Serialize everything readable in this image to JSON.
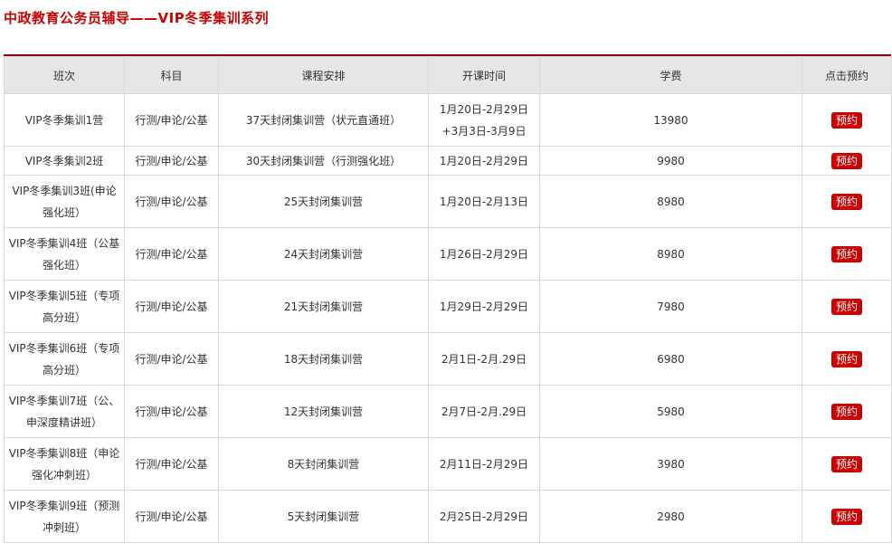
{
  "page": {
    "title": "中政教育公务员辅导——VIP冬季集训系列"
  },
  "colors": {
    "accent": "#cc0000",
    "header_bg": "#e6e6e6",
    "class_text": "#5a3b5c"
  },
  "table": {
    "headers": [
      "班次",
      "科目",
      "课程安排",
      "开课时间",
      "学费",
      "点击预约"
    ],
    "reserve_label": "预约",
    "rows": [
      {
        "class": "VIP冬季集训1营",
        "subject": "行测/申论/公基",
        "schedule": "37天封闭集训营（状元直通班）",
        "start": "1月20日-2月29日+3月3日-3月9日",
        "fee": "13980"
      },
      {
        "class": "VIP冬季集训2班",
        "subject": "行测/申论/公基",
        "schedule": "30天封闭集训营（行测强化班）",
        "start": "1月20日-2月29日",
        "fee": "9980"
      },
      {
        "class": "VIP冬季集训3班(申论强化班）",
        "subject": "行测/申论/公基",
        "schedule": "25天封闭集训营",
        "start": "1月20日-2月13日",
        "fee": "8980"
      },
      {
        "class": "VIP冬季集训4班（公基强化班）",
        "subject": "行测/申论/公基",
        "schedule": "24天封闭集训营",
        "start": "1月26日-2月29日",
        "fee": "8980"
      },
      {
        "class": "VIP冬季集训5班（专项高分班）",
        "subject": "行测/申论/公基",
        "schedule": "21天封闭集训营",
        "start": "1月29日-2月29日",
        "fee": "7980"
      },
      {
        "class": "VIP冬季集训6班（专项高分班）",
        "subject": "行测/申论/公基",
        "schedule": "18天封闭集训营",
        "start": "2月1日-2月.29日",
        "fee": "6980"
      },
      {
        "class": "VIP冬季集训7班（公、申深度精讲班）",
        "subject": "行测/申论/公基",
        "schedule": "12天封闭集训营",
        "start": "2月7日-2月.29日",
        "fee": "5980"
      },
      {
        "class": "VIP冬季集训8班（申论强化冲刺班）",
        "subject": "行测/申论/公基",
        "schedule": "8天封闭集训营",
        "start": "2月11日-2月29日",
        "fee": "3980"
      },
      {
        "class": "VIP冬季集训9班（预测冲刺班）",
        "subject": "行测/申论/公基",
        "schedule": "5天封闭集训营",
        "start": "2月25日-2月29日",
        "fee": "2980"
      }
    ]
  }
}
